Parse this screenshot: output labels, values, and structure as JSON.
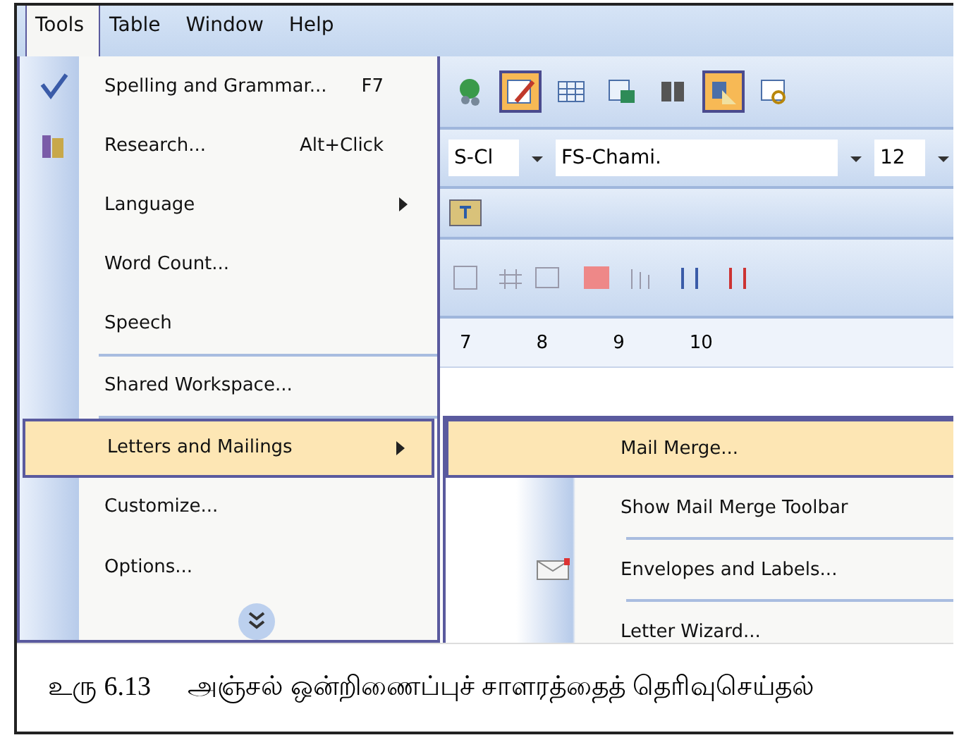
{
  "menubar": [
    {
      "label": "Tools",
      "selected": true
    },
    {
      "label": "Table",
      "selected": false
    },
    {
      "label": "Window",
      "selected": false
    },
    {
      "label": "Help",
      "selected": false
    }
  ],
  "tools_menu": [
    {
      "kind": "command",
      "label": "Spelling and Grammar...",
      "shortcut": "F7",
      "selected": false
    },
    {
      "kind": "command",
      "label": "Research...",
      "shortcut": "Alt+Click",
      "selected": false
    },
    {
      "kind": "submenu",
      "label": "Language",
      "selected": false
    },
    {
      "kind": "command",
      "label": "Word Count...",
      "selected": false
    },
    {
      "kind": "command",
      "label": "Speech",
      "selected": false
    },
    {
      "kind": "separator"
    },
    {
      "kind": "command",
      "label": "Shared Workspace...",
      "selected": false
    },
    {
      "kind": "separator"
    },
    {
      "kind": "submenu",
      "label": "Letters and Mailings",
      "selected": true
    },
    {
      "kind": "command",
      "label": "Customize...",
      "selected": false
    },
    {
      "kind": "command",
      "label": "Options...",
      "selected": false
    }
  ],
  "toolbar": [
    {
      "highlighted": false
    },
    {
      "highlighted": true
    },
    {
      "highlighted": false
    },
    {
      "highlighted": false
    },
    {
      "highlighted": false
    },
    {
      "highlighted": true
    },
    {
      "highlighted": false
    }
  ],
  "formatting": {
    "style": "S-Cl",
    "font": "FS-Chami.",
    "size": "12"
  },
  "ruler": [
    "7",
    "8",
    "9",
    "10"
  ],
  "submenu": [
    {
      "kind": "command",
      "label": "Mail Merge...",
      "selected": true
    },
    {
      "kind": "command",
      "label": "Show Mail Merge Toolbar",
      "selected": false
    },
    {
      "kind": "separator"
    },
    {
      "kind": "command",
      "label": "Envelopes and Labels...",
      "selected": false
    },
    {
      "kind": "separator"
    },
    {
      "kind": "command",
      "label": "Letter Wizard...",
      "selected": false
    }
  ],
  "caption": {
    "number": "உரு 6.13",
    "text": "அஞ்சல் ஒன்றிணைப்புச் சாளரத்தைத் தெரிவுசெய்தல்"
  }
}
